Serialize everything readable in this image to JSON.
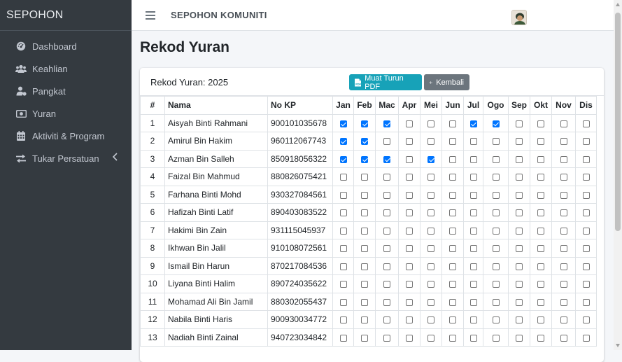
{
  "brand": "SEPOHON",
  "sidebar": {
    "items": [
      {
        "label": "Dashboard",
        "icon": "dashboard-icon"
      },
      {
        "label": "Keahlian",
        "icon": "users-icon"
      },
      {
        "label": "Pangkat",
        "icon": "user-rank-icon"
      },
      {
        "label": "Yuran",
        "icon": "money-icon"
      },
      {
        "label": "Aktiviti & Program",
        "icon": "calendar-icon"
      },
      {
        "label": "Tukar Persatuan",
        "icon": "exchange-icon"
      }
    ]
  },
  "topbar": {
    "title": "SEPOHON KOMUNITI"
  },
  "page": {
    "title": "Rekod Yuran"
  },
  "card": {
    "title": "Rekod Yuran: 2025",
    "pdf_label": "Muat Turun PDF",
    "back_label": "Kembali"
  },
  "table": {
    "headers": [
      "#",
      "Nama",
      "No KP",
      "Jan",
      "Feb",
      "Mac",
      "Apr",
      "Mei",
      "Jun",
      "Jul",
      "Ogo",
      "Sep",
      "Okt",
      "Nov",
      "Dis"
    ],
    "rows": [
      {
        "no": "1",
        "nama": "Aisyah Binti Rahmani",
        "kp": "900101035678",
        "paid": [
          1,
          1,
          1,
          0,
          0,
          0,
          1,
          1,
          0,
          0,
          0,
          0
        ]
      },
      {
        "no": "2",
        "nama": "Amirul Bin Hakim",
        "kp": "960112067743",
        "paid": [
          1,
          1,
          0,
          0,
          0,
          0,
          0,
          0,
          0,
          0,
          0,
          0
        ]
      },
      {
        "no": "3",
        "nama": "Azman Bin Salleh",
        "kp": "850918056322",
        "paid": [
          1,
          1,
          1,
          0,
          1,
          0,
          0,
          0,
          0,
          0,
          0,
          0
        ]
      },
      {
        "no": "4",
        "nama": "Faizal Bin Mahmud",
        "kp": "880826075421",
        "paid": [
          0,
          0,
          0,
          0,
          0,
          0,
          0,
          0,
          0,
          0,
          0,
          0
        ]
      },
      {
        "no": "5",
        "nama": "Farhana Binti Mohd",
        "kp": "930327084561",
        "paid": [
          0,
          0,
          0,
          0,
          0,
          0,
          0,
          0,
          0,
          0,
          0,
          0
        ]
      },
      {
        "no": "6",
        "nama": "Hafizah Binti Latif",
        "kp": "890403083522",
        "paid": [
          0,
          0,
          0,
          0,
          0,
          0,
          0,
          0,
          0,
          0,
          0,
          0
        ]
      },
      {
        "no": "7",
        "nama": "Hakimi Bin Zain",
        "kp": "931115045937",
        "paid": [
          0,
          0,
          0,
          0,
          0,
          0,
          0,
          0,
          0,
          0,
          0,
          0
        ]
      },
      {
        "no": "8",
        "nama": "Ikhwan Bin Jalil",
        "kp": "910108072561",
        "paid": [
          0,
          0,
          0,
          0,
          0,
          0,
          0,
          0,
          0,
          0,
          0,
          0
        ]
      },
      {
        "no": "9",
        "nama": "Ismail Bin Harun",
        "kp": "870217084536",
        "paid": [
          0,
          0,
          0,
          0,
          0,
          0,
          0,
          0,
          0,
          0,
          0,
          0
        ]
      },
      {
        "no": "10",
        "nama": "Liyana Binti Halim",
        "kp": "890724035622",
        "paid": [
          0,
          0,
          0,
          0,
          0,
          0,
          0,
          0,
          0,
          0,
          0,
          0
        ]
      },
      {
        "no": "11",
        "nama": "Mohamad Ali Bin Jamil",
        "kp": "880302055437",
        "paid": [
          0,
          0,
          0,
          0,
          0,
          0,
          0,
          0,
          0,
          0,
          0,
          0
        ]
      },
      {
        "no": "12",
        "nama": "Nabila Binti Haris",
        "kp": "900930034772",
        "paid": [
          0,
          0,
          0,
          0,
          0,
          0,
          0,
          0,
          0,
          0,
          0,
          0
        ]
      },
      {
        "no": "13",
        "nama": "Nadiah Binti Zainal",
        "kp": "940723034842",
        "paid": [
          0,
          0,
          0,
          0,
          0,
          0,
          0,
          0,
          0,
          0,
          0,
          0
        ]
      }
    ]
  },
  "colors": {
    "sidebar": "#343a40",
    "info": "#17a2b8",
    "secondary": "#6c757d",
    "checkbox": "#0075ff"
  }
}
